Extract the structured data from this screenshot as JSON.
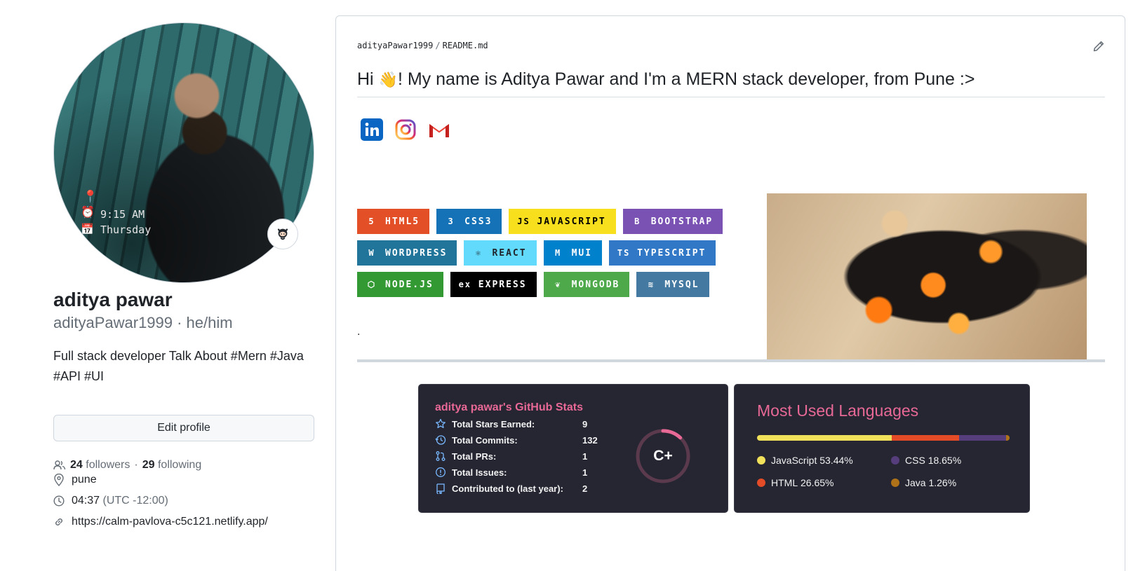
{
  "profile": {
    "avatar_overlay_time": "9:15 AM",
    "avatar_overlay_day": "Thursday",
    "name": "aditya pawar",
    "login_line": "adityaPawar1999 · he/him",
    "bio": "Full stack developer Talk About #Mern #Java #API #UI",
    "edit_button": "Edit profile",
    "followers_count": "24",
    "followers_label": "followers",
    "separator": "·",
    "following_count": "29",
    "following_label": "following",
    "location": "pune",
    "local_time": "04:37",
    "timezone": "(UTC -12:00)",
    "website": "https://calm-pavlova-c5c121.netlify.app/"
  },
  "readme": {
    "crumb_owner": "adityaPawar1999",
    "crumb_sep": "/",
    "crumb_file": "README",
    "crumb_ext": ".md",
    "heading_pre": "Hi",
    "heading_wave": "👋",
    "heading_post": "! My name is Aditya Pawar and I'm a MERN stack developer, from Pune :>",
    "dot_text": ".",
    "socials": [
      "linkedin-icon",
      "instagram-icon",
      "gmail-icon"
    ],
    "badges": [
      [
        {
          "label": "HTML5",
          "color": "#e34f26",
          "icon": "html5-icon",
          "glyph": "5"
        },
        {
          "label": "CSS3",
          "color": "#1572b6",
          "icon": "css3-icon",
          "glyph": "3"
        },
        {
          "label": "JAVASCRIPT",
          "color": "#f7df1e",
          "text": "#000000",
          "icon": "javascript-icon",
          "glyph": "JS"
        },
        {
          "label": "BOOTSTRAP",
          "color": "#7952b3",
          "icon": "bootstrap-icon",
          "glyph": "B"
        }
      ],
      [
        {
          "label": "WORDPRESS",
          "color": "#21759b",
          "icon": "wordpress-icon",
          "glyph": "W"
        },
        {
          "label": "REACT",
          "color": "#61dafb",
          "text": "#20232a",
          "icon": "react-icon",
          "glyph": "⚛"
        },
        {
          "label": "MUI",
          "color": "#0081cb",
          "icon": "mui-icon",
          "glyph": "M"
        },
        {
          "label": "TYPESCRIPT",
          "color": "#3178c6",
          "icon": "typescript-icon",
          "glyph": "TS"
        }
      ],
      [
        {
          "label": "NODE.JS",
          "color": "#339933",
          "icon": "nodejs-icon",
          "glyph": "⬡"
        },
        {
          "label": "EXPRESS",
          "color": "#000000",
          "icon": "express-icon",
          "glyph": "ex"
        },
        {
          "label": "MONGODB",
          "color": "#4ea94b",
          "icon": "mongodb-icon",
          "glyph": "❦"
        },
        {
          "label": "MYSQL",
          "color": "#4479a1",
          "icon": "mysql-icon",
          "glyph": "≋"
        }
      ]
    ]
  },
  "stats": {
    "title": "aditya pawar's GitHub Stats",
    "rows": [
      {
        "icon": "star-icon",
        "label": "Total Stars Earned:",
        "value": "9"
      },
      {
        "icon": "history-icon",
        "label": "Total Commits:",
        "value": "132"
      },
      {
        "icon": "pull-request-icon",
        "label": "Total PRs:",
        "value": "1"
      },
      {
        "icon": "issue-icon",
        "label": "Total Issues:",
        "value": "1"
      },
      {
        "icon": "repo-icon",
        "label": "Contributed to (last year):",
        "value": "2"
      }
    ],
    "grade": "C+",
    "grade_progress": 0.12
  },
  "languages": {
    "title": "Most Used Languages",
    "items": [
      {
        "name": "JavaScript",
        "percent": "53.44%",
        "value": 53.44,
        "color": "#f1e05a"
      },
      {
        "name": "HTML",
        "percent": "26.65%",
        "value": 26.65,
        "color": "#e34c26"
      },
      {
        "name": "CSS",
        "percent": "18.65%",
        "value": 18.65,
        "color": "#563d7c"
      },
      {
        "name": "Java",
        "percent": "1.26%",
        "value": 1.26,
        "color": "#b07219"
      }
    ]
  },
  "colors": {
    "accent_pink": "#e86896",
    "card_bg": "#252632",
    "stat_icon": "#79b8ff"
  }
}
